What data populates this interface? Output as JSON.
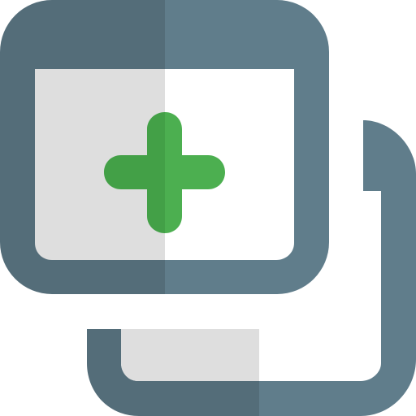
{
  "icon": {
    "name": "new-window-icon",
    "parts": [
      "front-window-icon",
      "back-window-icon",
      "plus-icon"
    ]
  },
  "colors": {
    "frame_light": "#607d8b",
    "frame_dark": "#546d79",
    "pane_light": "#ffffff",
    "pane_dark": "#dedede",
    "plus_light": "#4caf50",
    "plus_dark": "#43a047"
  }
}
